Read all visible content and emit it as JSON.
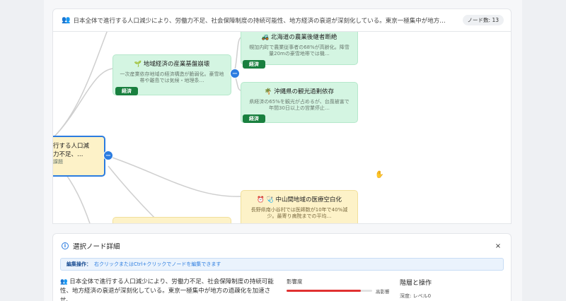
{
  "topbar": {
    "icon": "people-icon",
    "title_text": "日本全体で進行する人口減少により、労働力不足、社会保障制度の持続可能性、地方経済の衰退が深刻化している。東京一極集中が地方…",
    "node_count": "ノード数: 13"
  },
  "nodes": {
    "root": {
      "line1": "行する人口減",
      "line2": "力不足、…",
      "sub": "課題"
    },
    "regional": {
      "icon": "seedling-icon",
      "title": "地域経済の産業基盤崩壊",
      "desc": "一次産業依存地域の経済構造が脆弱化。豪雪地帯や離島では気候・地理条…",
      "tag": "経済"
    },
    "hokkaido": {
      "icon": "tractor-icon",
      "title": "北海道の農業後継者断絶",
      "desc": "幌加内町で農業従事者の68%が高齢化。降雪量20mの豪雪地帯では機…",
      "tag": "経済"
    },
    "okinawa": {
      "icon": "palm-tree-icon",
      "title": "沖縄県の観光過剰依存",
      "desc": "県経済の65%を観光が占めるが、台風被害で年間30日以上の営業停止…",
      "tag": "経済"
    },
    "medical": {
      "icon": "medical-icon",
      "title": "中山間地域の医療空白化",
      "desc": "長野県南小谷村では医師数が10年で40%減少。最寄り病院までの平均…"
    }
  },
  "buttons": {
    "collapse_symbol": "−"
  },
  "details": {
    "title": "選択ノード詳細",
    "close_symbol": "×",
    "edit_label": "編集操作：",
    "edit_hint": "右クリックまたはCtrl+クリックでノードを編集できます",
    "body_text": "日本全体で進行する人口減少により、労働力不足、社会保障制度の持続可能性、地方経済の衰退が深刻化している。東京一極集中が地方の過疎化を加速させ、",
    "impact_label": "影響度",
    "impact_high": "高影響",
    "impact_value": 0.87,
    "ops_title": "階層と操作",
    "depth": "深度: レベル0"
  },
  "colors": {
    "accent": "#2b7ce0",
    "tag_green": "#19803f",
    "impact_red": "#e03131"
  }
}
